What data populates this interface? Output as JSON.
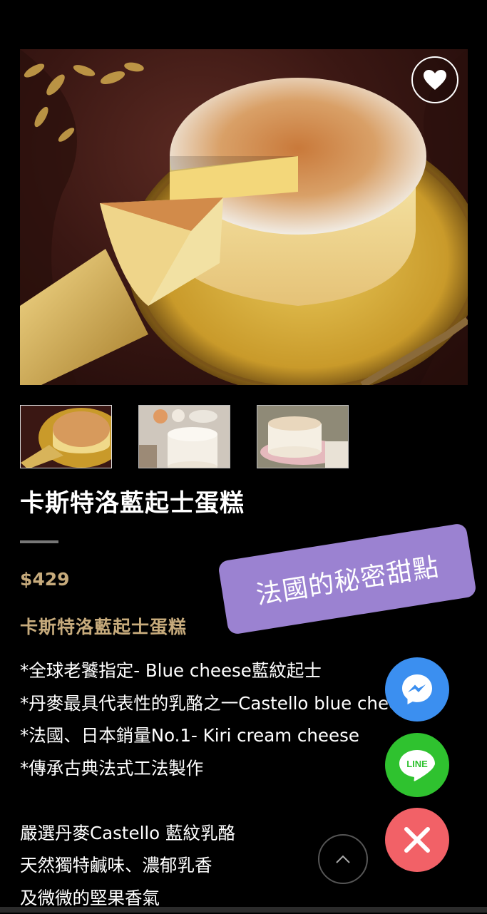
{
  "product": {
    "title": "卡斯特洛藍起士蛋糕",
    "price": "$429",
    "subtitle": "卡斯特洛藍起士蛋糕",
    "description_lines": [
      "*全球老饕指定- Blue cheese藍紋起士",
      "*丹麥最具代表性的乳酪之一Castello blue cheese",
      "*法國、日本銷量No.1- Kiri cream cheese",
      "*傳承古典法式工法製作",
      "",
      "嚴選丹麥Castello 藍紋乳酪",
      "天然獨特鹹味、濃郁乳香",
      "及微微的堅果香氣"
    ]
  },
  "promo_tag": "法國的秘密甜點",
  "icons": {
    "favorite": "heart-icon",
    "messenger": "messenger-icon",
    "line": "line-icon",
    "close": "close-icon",
    "scroll_top": "chevron-up-icon"
  },
  "line_label": "LINE",
  "colors": {
    "accent_gold": "#c7ab7c",
    "promo_purple": "#9b82d1",
    "messenger_blue": "#3b8ff0",
    "line_green": "#2fc22f",
    "close_red": "#f26167"
  }
}
